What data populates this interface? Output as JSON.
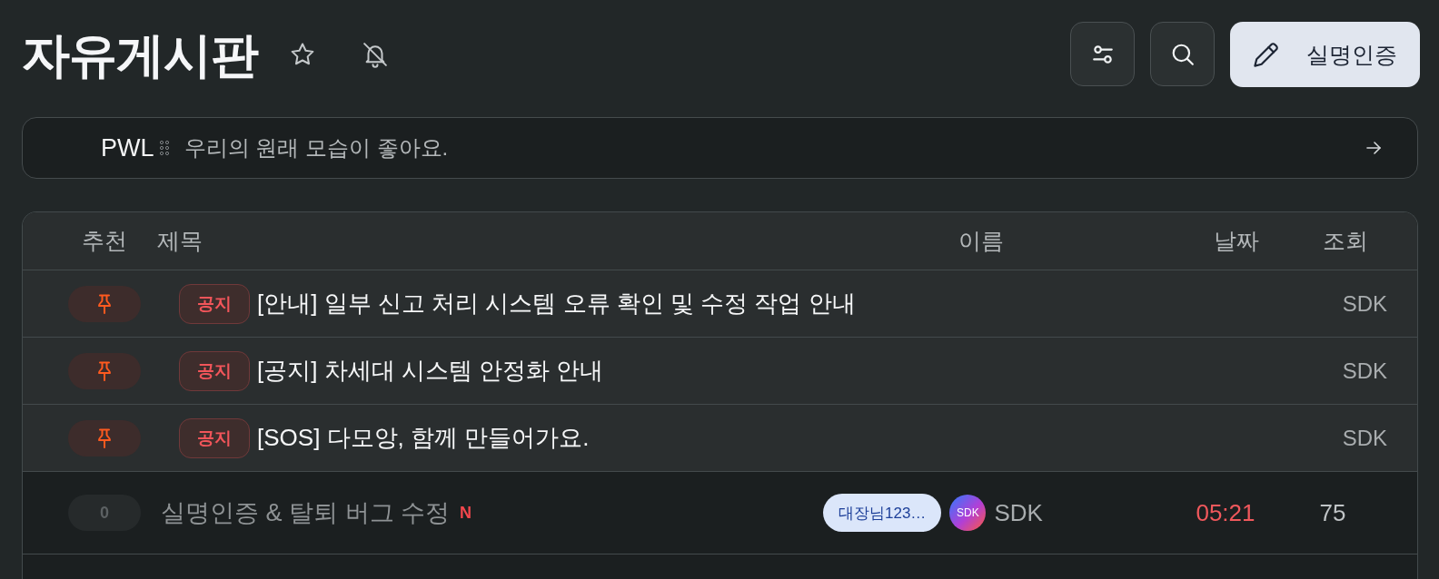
{
  "header": {
    "title": "자유게시판",
    "starred": false,
    "notifications": false
  },
  "actions": [
    {
      "kind": "filter"
    },
    {
      "kind": "search"
    },
    {
      "kind": "primary",
      "label": "실명인증"
    }
  ],
  "banner": {
    "tag": "PWL",
    "text": "우리의 원래 모습이 좋아요."
  },
  "table": {
    "columns": [
      "추천",
      "제목",
      "이름",
      "날짜",
      "조회"
    ],
    "rows": [
      {
        "kind": "notice",
        "tag": "공지",
        "title": "[안내] 일부 신고 처리 시스템 오류 확인 및 수정 작업 안내",
        "author": "SDK"
      },
      {
        "kind": "notice",
        "tag": "공지",
        "title": "[공지] 차세대 시스템 안정화 안내",
        "author": "SDK"
      },
      {
        "kind": "notice",
        "tag": "공지",
        "title": "[SOS] 다모앙, 함께 만들어가요.",
        "author": "SDK"
      },
      {
        "kind": "post",
        "votes": "0",
        "title": "실명인증 & 탈퇴 버그 수정",
        "new_mark": "N",
        "badge": "대장님123…",
        "avatar": "SDK",
        "author": "SDK",
        "date": "05:21",
        "views": "75"
      }
    ]
  }
}
